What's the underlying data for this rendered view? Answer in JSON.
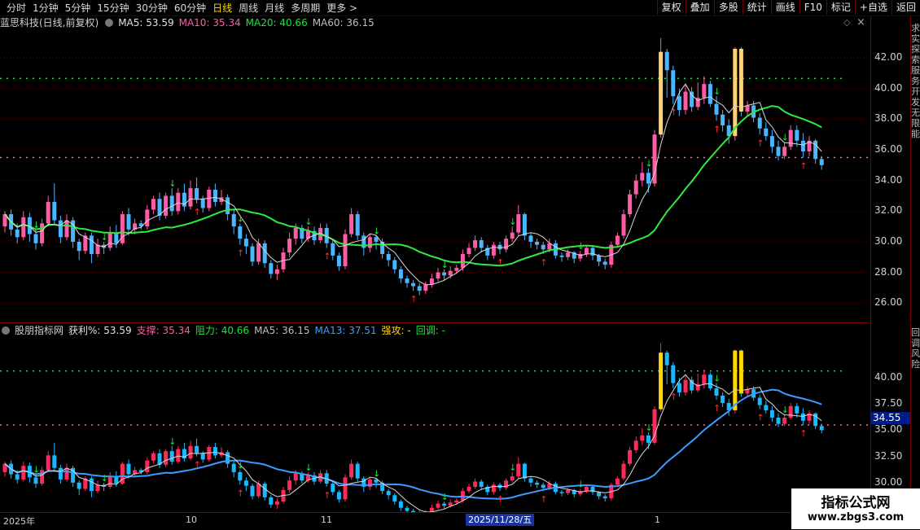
{
  "toolbar": {
    "tabs": [
      {
        "label": "分时"
      },
      {
        "label": "1分钟"
      },
      {
        "label": "5分钟"
      },
      {
        "label": "15分钟"
      },
      {
        "label": "30分钟"
      },
      {
        "label": "60分钟"
      },
      {
        "label": "日线",
        "active": true
      },
      {
        "label": "周线"
      },
      {
        "label": "月线"
      },
      {
        "label": "多周期"
      },
      {
        "label": "更多 >"
      }
    ],
    "right_buttons": [
      "复权",
      "叠加",
      "多股",
      "统计",
      "画线",
      "F10",
      "标记",
      "+自选",
      "返回"
    ]
  },
  "main_panel": {
    "title": "蓝思科技(日线,前复权)",
    "indicators": [
      {
        "label": "MA5: 53.59",
        "color": "#e0e0e0"
      },
      {
        "label": "MA10: 35.34",
        "color": "#ff5ca8"
      },
      {
        "label": "MA20: 40.66",
        "color": "#19e63c"
      },
      {
        "label": "MA60: 36.15",
        "color": "#bfbfbf"
      }
    ],
    "y_ticks": [
      "42.00",
      "40.00",
      "38.00",
      "36.00",
      "34.00",
      "32.00",
      "30.00",
      "28.00",
      "26.00"
    ],
    "side_text": "求实探索服务开发无限能"
  },
  "sub_panel": {
    "title": "股朋指标网",
    "indicators": [
      {
        "label": "获利%: 53.59",
        "color": "#e0e0e0"
      },
      {
        "label": "支撑: 35.34",
        "color": "#ff5ca8"
      },
      {
        "label": "阻力: 40.66",
        "color": "#19e63c"
      },
      {
        "label": "MA5: 36.15",
        "color": "#bfbfbf"
      },
      {
        "label": "MA13: 37.51",
        "color": "#3aa0ff"
      },
      {
        "label": "强攻: -",
        "color": "#ffd800"
      },
      {
        "label": "回调: -",
        "color": "#19e63c"
      }
    ],
    "y_ticks": [
      "40.00",
      "37.50",
      "35.00",
      "32.50",
      "30.00"
    ],
    "price_box": "34.55",
    "side_text": "回调风险"
  },
  "date_axis": {
    "labels": [
      "2025年",
      "10",
      "11",
      "1"
    ],
    "highlight": "2025/11/28/五"
  },
  "watermark": {
    "line1": "指标公式网",
    "line2": "www.zbgs3.com"
  },
  "chart_data": {
    "type": "candlestick",
    "title": "蓝思科技(日线,前复权)",
    "ylim": [
      25.0,
      43.5
    ],
    "ref_lines": {
      "resistance": 40.66,
      "support": 35.5
    },
    "candles": [
      [
        31.0,
        31.8,
        30.6,
        32.0
      ],
      [
        31.8,
        30.8,
        30.4,
        32.1
      ],
      [
        30.8,
        30.3,
        29.9,
        31.2
      ],
      [
        30.3,
        31.6,
        30.1,
        32.0
      ],
      [
        31.6,
        30.5,
        30.0,
        31.9
      ],
      [
        30.5,
        29.9,
        29.5,
        30.8
      ],
      [
        29.9,
        31.2,
        29.7,
        31.5
      ],
      [
        31.2,
        32.6,
        31.0,
        33.0
      ],
      [
        32.6,
        31.4,
        31.1,
        33.8
      ],
      [
        31.4,
        30.3,
        29.9,
        31.7
      ],
      [
        30.3,
        31.4,
        30.1,
        31.8
      ],
      [
        31.4,
        30.0,
        29.6,
        31.6
      ],
      [
        30.0,
        29.4,
        28.8,
        30.2
      ],
      [
        29.4,
        30.4,
        29.2,
        30.6
      ],
      [
        30.4,
        29.2,
        28.6,
        30.6
      ],
      [
        29.2,
        29.8,
        29.0,
        30.2
      ],
      [
        29.8,
        29.6,
        29.2,
        30.0
      ],
      [
        29.6,
        30.6,
        29.4,
        31.0
      ],
      [
        30.6,
        29.9,
        29.6,
        31.1
      ],
      [
        29.9,
        31.8,
        29.8,
        32.0
      ],
      [
        31.8,
        30.8,
        30.4,
        32.2
      ],
      [
        30.8,
        31.2,
        30.5,
        31.5
      ],
      [
        31.2,
        31.0,
        30.8,
        31.4
      ],
      [
        31.0,
        32.1,
        30.8,
        32.4
      ],
      [
        32.1,
        32.8,
        31.8,
        33.0
      ],
      [
        32.8,
        31.7,
        31.4,
        33.2
      ],
      [
        31.7,
        33.0,
        31.5,
        33.2
      ],
      [
        33.0,
        32.0,
        31.7,
        33.5
      ],
      [
        32.0,
        33.2,
        31.8,
        33.5
      ],
      [
        33.2,
        32.3,
        32.0,
        33.8
      ],
      [
        32.3,
        33.5,
        32.1,
        34.0
      ],
      [
        33.5,
        32.8,
        32.5,
        34.2
      ],
      [
        32.8,
        32.2,
        31.9,
        33.0
      ],
      [
        32.2,
        33.4,
        32.0,
        33.6
      ],
      [
        33.4,
        32.6,
        32.3,
        33.8
      ],
      [
        32.6,
        32.9,
        32.4,
        33.4
      ],
      [
        32.9,
        31.8,
        31.4,
        33.1
      ],
      [
        31.8,
        31.0,
        30.5,
        32.1
      ],
      [
        31.0,
        30.2,
        29.8,
        31.2
      ],
      [
        30.2,
        29.7,
        29.2,
        30.5
      ],
      [
        29.7,
        28.7,
        28.4,
        29.9
      ],
      [
        28.7,
        29.9,
        28.5,
        30.2
      ],
      [
        29.9,
        28.6,
        28.3,
        30.1
      ],
      [
        28.6,
        27.9,
        27.6,
        28.8
      ],
      [
        27.9,
        28.2,
        27.5,
        28.5
      ],
      [
        28.2,
        29.3,
        28.0,
        29.6
      ],
      [
        29.3,
        30.2,
        29.0,
        30.6
      ],
      [
        30.2,
        30.9,
        29.8,
        31.2
      ],
      [
        30.9,
        30.2,
        29.9,
        31.1
      ],
      [
        30.2,
        30.7,
        30.0,
        31.0
      ],
      [
        30.7,
        30.1,
        29.8,
        31.0
      ],
      [
        30.1,
        30.9,
        29.9,
        31.2
      ],
      [
        30.9,
        29.9,
        29.6,
        31.2
      ],
      [
        29.9,
        29.1,
        28.8,
        30.1
      ],
      [
        29.1,
        28.4,
        28.1,
        29.3
      ],
      [
        28.4,
        30.5,
        28.2,
        30.8
      ],
      [
        30.5,
        31.8,
        30.3,
        32.2
      ],
      [
        31.8,
        30.4,
        30.1,
        32.0
      ],
      [
        30.4,
        29.6,
        29.1,
        30.6
      ],
      [
        29.6,
        30.3,
        29.3,
        30.5
      ],
      [
        30.3,
        30.0,
        29.5,
        30.4
      ],
      [
        30.0,
        29.2,
        28.9,
        30.2
      ],
      [
        29.2,
        28.8,
        28.4,
        29.4
      ],
      [
        28.8,
        28.2,
        27.9,
        29.0
      ],
      [
        28.2,
        27.6,
        27.3,
        28.4
      ],
      [
        27.6,
        27.3,
        27.0,
        27.8
      ],
      [
        27.3,
        27.1,
        26.8,
        27.5
      ],
      [
        27.1,
        26.8,
        26.5,
        27.3
      ],
      [
        26.8,
        27.2,
        26.6,
        27.4
      ],
      [
        27.2,
        27.6,
        27.0,
        27.9
      ],
      [
        27.6,
        28.0,
        27.4,
        28.3
      ],
      [
        28.0,
        27.8,
        27.5,
        28.2
      ],
      [
        27.8,
        28.1,
        27.6,
        28.4
      ],
      [
        28.1,
        28.3,
        27.9,
        28.5
      ],
      [
        28.3,
        29.2,
        28.1,
        29.5
      ],
      [
        29.2,
        29.6,
        29.0,
        29.9
      ],
      [
        29.6,
        30.1,
        29.4,
        30.4
      ],
      [
        30.1,
        29.6,
        29.3,
        30.3
      ],
      [
        29.6,
        29.1,
        28.8,
        29.8
      ],
      [
        29.1,
        29.8,
        28.9,
        30.0
      ],
      [
        29.8,
        29.5,
        29.2,
        30.0
      ],
      [
        29.5,
        30.2,
        29.3,
        30.4
      ],
      [
        30.2,
        30.6,
        30.0,
        31.0
      ],
      [
        30.6,
        31.8,
        30.4,
        32.4
      ],
      [
        31.8,
        30.4,
        30.1,
        31.9
      ],
      [
        30.4,
        30.0,
        29.6,
        30.6
      ],
      [
        30.0,
        29.8,
        29.5,
        30.2
      ],
      [
        29.8,
        29.5,
        29.2,
        30.0
      ],
      [
        29.5,
        29.9,
        29.3,
        30.2
      ],
      [
        29.9,
        29.1,
        28.9,
        30.1
      ],
      [
        29.1,
        29.0,
        28.7,
        29.3
      ],
      [
        29.0,
        29.3,
        28.8,
        29.5
      ],
      [
        29.3,
        28.9,
        28.6,
        29.4
      ],
      [
        28.9,
        29.2,
        28.7,
        29.4
      ],
      [
        29.2,
        29.6,
        29.0,
        29.8
      ],
      [
        29.6,
        29.1,
        28.8,
        29.7
      ],
      [
        29.1,
        28.7,
        28.4,
        29.2
      ],
      [
        28.7,
        28.5,
        28.2,
        28.9
      ],
      [
        28.5,
        29.8,
        28.3,
        30.0
      ],
      [
        29.8,
        30.4,
        29.6,
        30.6
      ],
      [
        30.4,
        31.8,
        30.2,
        32.1
      ],
      [
        31.8,
        33.1,
        31.6,
        33.4
      ],
      [
        33.1,
        34.0,
        32.8,
        34.4
      ],
      [
        34.0,
        34.5,
        33.6,
        35.2
      ],
      [
        34.5,
        33.8,
        33.2,
        34.8
      ],
      [
        33.8,
        37.0,
        33.6,
        37.3
      ],
      [
        37.0,
        42.4,
        36.8,
        43.3
      ],
      [
        42.4,
        41.2,
        39.4,
        42.6
      ],
      [
        41.2,
        39.5,
        39.0,
        41.5
      ],
      [
        39.5,
        38.6,
        38.2,
        40.0
      ],
      [
        38.6,
        39.8,
        38.3,
        40.2
      ],
      [
        39.8,
        38.8,
        38.5,
        40.1
      ],
      [
        38.8,
        39.4,
        38.6,
        40.4
      ],
      [
        39.4,
        40.3,
        39.0,
        40.8
      ],
      [
        40.3,
        39.0,
        38.8,
        40.5
      ],
      [
        39.0,
        38.3,
        37.9,
        39.5
      ],
      [
        38.3,
        37.6,
        37.2,
        38.6
      ],
      [
        37.6,
        36.9,
        36.4,
        38.0
      ],
      [
        36.9,
        42.6,
        36.6,
        42.7
      ],
      [
        42.6,
        38.5,
        38.2,
        42.7
      ],
      [
        38.5,
        38.9,
        38.2,
        39.2
      ],
      [
        38.9,
        38.1,
        37.8,
        39.2
      ],
      [
        38.1,
        37.4,
        37.0,
        38.4
      ],
      [
        37.4,
        36.9,
        36.6,
        37.8
      ],
      [
        36.9,
        36.2,
        35.8,
        37.3
      ],
      [
        36.2,
        35.6,
        35.3,
        36.6
      ],
      [
        35.6,
        36.2,
        35.4,
        36.5
      ],
      [
        36.2,
        37.3,
        36.0,
        37.6
      ],
      [
        37.3,
        36.6,
        36.2,
        37.6
      ],
      [
        36.6,
        35.9,
        35.5,
        37.1
      ],
      [
        35.9,
        36.6,
        35.6,
        36.9
      ],
      [
        36.6,
        35.4,
        35.1,
        36.7
      ],
      [
        35.4,
        35.0,
        34.7,
        35.6
      ]
    ]
  }
}
